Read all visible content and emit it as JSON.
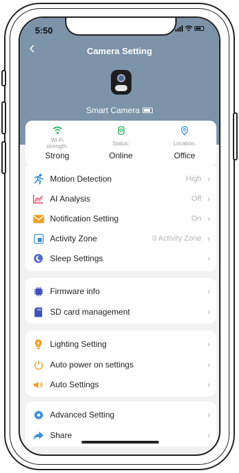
{
  "status_bar": {
    "time": "5:50"
  },
  "header": {
    "back_icon": "chevron-left-icon",
    "title": "Camera Setting",
    "device_name": "Smart Camera",
    "bg_color": "#7c93a8"
  },
  "stats": [
    {
      "icon": "wifi-icon",
      "label": "Wi-Fi strength:",
      "value": "Strong",
      "color": "#21b25a"
    },
    {
      "icon": "status-icon",
      "label": "Status:",
      "value": "Online",
      "color": "#21b25a"
    },
    {
      "icon": "location-pin-icon",
      "label": "Location:",
      "value": "Office",
      "color": "#3a8fd6"
    }
  ],
  "group1": [
    {
      "label": "Motion Detection",
      "value": "High",
      "icon": "running-person-icon",
      "color": "#3a8fd6"
    },
    {
      "label": "AI Analysis",
      "value": "Off",
      "icon": "chart-icon",
      "color": "#e0486a"
    },
    {
      "label": "Notification Setting",
      "value": "On",
      "icon": "envelope-icon",
      "color": "#f0a028"
    },
    {
      "label": "Activity Zone",
      "value": "0 Activity Zone",
      "icon": "zone-icon",
      "color": "#3a8fd6"
    },
    {
      "label": "Sleep Settings",
      "value": "",
      "icon": "moon-icon",
      "color": "#5468c8"
    }
  ],
  "group2": [
    {
      "label": "Firmware info",
      "icon": "chip-icon",
      "color": "#3f51b5"
    },
    {
      "label": "SD card management",
      "icon": "sd-card-icon",
      "color": "#3f51b5"
    }
  ],
  "group3": [
    {
      "label": "Lighting Setting",
      "icon": "bulb-icon",
      "color": "#f0a028"
    },
    {
      "label": "Auto power on settings",
      "icon": "power-icon",
      "color": "#f0a028"
    },
    {
      "label": "Auto Settings",
      "icon": "speaker-icon",
      "color": "#f0a028"
    }
  ],
  "group4": [
    {
      "label": "Advanced Setting",
      "icon": "gear-icon",
      "color": "#3a8fd6"
    },
    {
      "label": "Share",
      "icon": "share-arrow-icon",
      "color": "#3a8fd6"
    }
  ]
}
